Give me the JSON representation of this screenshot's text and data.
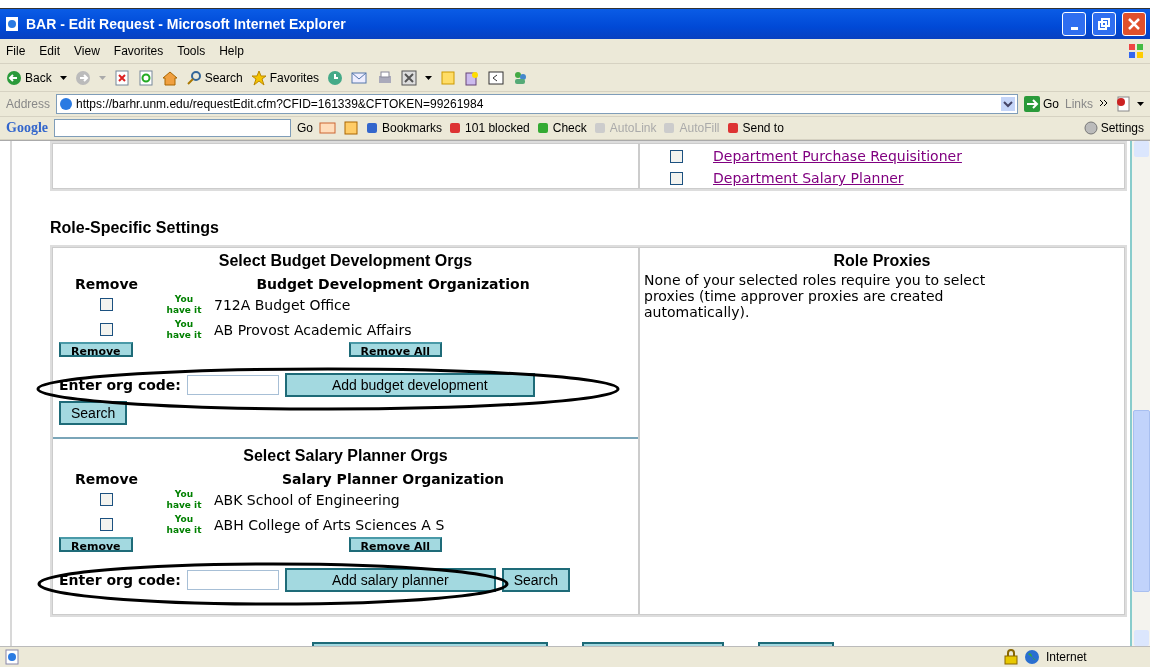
{
  "window": {
    "title": "BAR - Edit Request - Microsoft Internet Explorer"
  },
  "menu": [
    "File",
    "Edit",
    "View",
    "Favorites",
    "Tools",
    "Help"
  ],
  "toolbar": {
    "back": "Back",
    "search": "Search",
    "favorites": "Favorites"
  },
  "address": {
    "label": "Address",
    "value": "https://barhr.unm.edu/requestEdit.cfm?CFID=161339&CFTOKEN=99261984",
    "go": "Go",
    "links": "Links"
  },
  "google_bar": {
    "logo": "Google",
    "go": "Go",
    "items": [
      {
        "label": "Bookmarks",
        "disabled": false
      },
      {
        "label": "101 blocked",
        "disabled": false
      },
      {
        "label": "Check",
        "disabled": false
      },
      {
        "label": "AutoLink",
        "disabled": true
      },
      {
        "label": "AutoFill",
        "disabled": true
      },
      {
        "label": "Send to",
        "disabled": false
      }
    ],
    "settings": "Settings"
  },
  "roles": [
    {
      "label": "Department Purchase Requisitioner",
      "checked": false
    },
    {
      "label": "Department Salary Planner",
      "checked": false
    }
  ],
  "section_title": "Role-Specific Settings",
  "org_panels": [
    {
      "title": "Select Budget Development Orgs",
      "remove_header": "Remove",
      "org_header": "Budget Development Organization",
      "rows": [
        {
          "badge": "You have it",
          "name": "712A Budget Office",
          "checked": false
        },
        {
          "badge": "You have it",
          "name": "AB Provost Academic Affairs",
          "checked": false
        }
      ],
      "remove_button": "Remove",
      "remove_all_button": "Remove All",
      "code_label": "Enter org code:",
      "add_button": "Add budget development",
      "search_button": "Search",
      "highlighted": true
    },
    {
      "title": "Select Salary Planner Orgs",
      "remove_header": "Remove",
      "org_header": "Salary Planner Organization",
      "rows": [
        {
          "badge": "You have it",
          "name": "ABK School of Engineering",
          "checked": false
        },
        {
          "badge": "You have it",
          "name": "ABH College of Arts Sciences A S",
          "checked": false
        }
      ],
      "remove_button": "Remove",
      "remove_all_button": "Remove All",
      "code_label": "Enter org code:",
      "add_button": "Add salary planner",
      "search_button": "Search",
      "highlighted": true
    }
  ],
  "proxies": {
    "title": "Role Proxies",
    "text": "None of your selected roles require you to select proxies (time approver proxies are created automatically)."
  },
  "status": {
    "zone": "Internet"
  }
}
